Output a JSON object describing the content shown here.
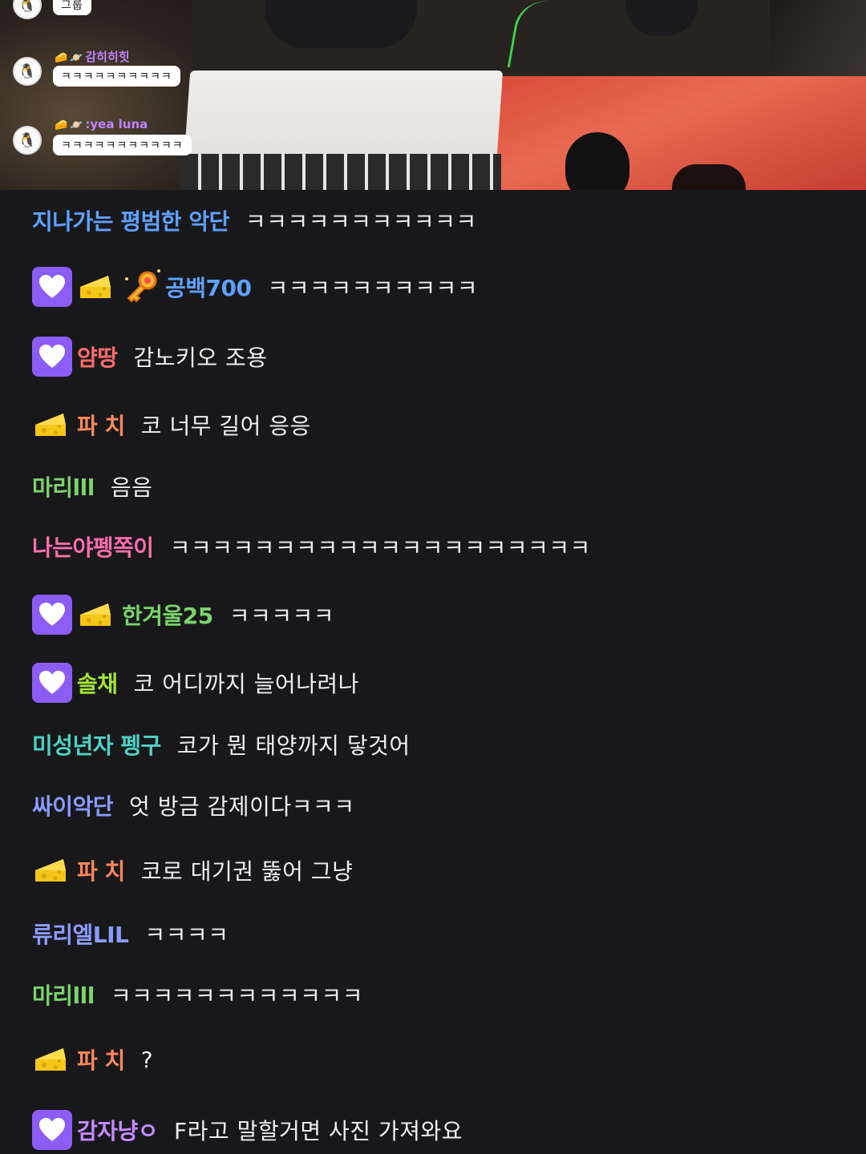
{
  "video_overlay": {
    "top_bubble": "그룹",
    "msg1": {
      "name": "감히히힛",
      "text": "ㅋㅋㅋㅋㅋㅋㅋㅋㅋㅋ"
    },
    "msg2": {
      "name": ":yea luna",
      "text": "ㅋㅋㅋㅋㅋㅋㅋㅋㅋㅋㅋ"
    }
  },
  "chat": {
    "messages": [
      {
        "user": "지나가는 평범한 악단",
        "color": "#5ea1ff",
        "badges": [],
        "text": "ㅋㅋㅋㅋㅋㅋㅋㅋㅋㅋㅋ"
      },
      {
        "user": "공백700",
        "color": "#5ea1ff",
        "badges": [
          "sub-heart-icon",
          "cheese-icon",
          "key-icon"
        ],
        "text": "ㅋㅋㅋㅋㅋㅋㅋㅋㅋㅋ"
      },
      {
        "user": "얌땅",
        "color": "#ff6b6b",
        "badges": [
          "sub-heart-icon"
        ],
        "text": "감노키오 조용"
      },
      {
        "user": "파 치",
        "color": "#ff8a5c",
        "badges": [
          "cheese-icon"
        ],
        "text": "코 너무 길어 응응"
      },
      {
        "user": "마리lll",
        "color": "#7bd36b",
        "badges": [],
        "text": "음음"
      },
      {
        "user": "나는야펭쪽이",
        "color": "#ff6fa8",
        "badges": [],
        "text": "ㅋㅋㅋㅋㅋㅋㅋㅋㅋㅋㅋㅋㅋㅋㅋㅋㅋㅋㅋㅋ"
      },
      {
        "user": "한겨울25",
        "color": "#7bd36b",
        "badges": [
          "sub-heart-icon",
          "cheese-icon"
        ],
        "text": "ㅋㅋㅋㅋㅋ"
      },
      {
        "user": "솔채",
        "color": "#a3e635",
        "badges": [
          "sub-heart-icon"
        ],
        "text": "코 어디까지 늘어나려나"
      },
      {
        "user": "미성년자 펭구",
        "color": "#4fd1c5",
        "badges": [],
        "text": "코가 뭔 태양까지 닿것어"
      },
      {
        "user": "싸이악단",
        "color": "#8b9cff",
        "badges": [],
        "text": "엇 방금 감제이다ㅋㅋㅋ"
      },
      {
        "user": "파 치",
        "color": "#ff8a5c",
        "badges": [
          "cheese-icon"
        ],
        "text": "코로 대기권 뚫어 그냥"
      },
      {
        "user": "류리엘LIL",
        "color": "#8b9cff",
        "badges": [],
        "text": "ㅋㅋㅋㅋ"
      },
      {
        "user": "마리lll",
        "color": "#7bd36b",
        "badges": [],
        "text": "ㅋㅋㅋㅋㅋㅋㅋㅋㅋㅋㅋㅋ"
      },
      {
        "user": "파 치",
        "color": "#ff8a5c",
        "badges": [
          "cheese-icon"
        ],
        "text": "?"
      },
      {
        "user": "감자냥ㅇ",
        "color": "#c48cff",
        "badges": [
          "sub-heart-icon"
        ],
        "text": "F라고 말할거면 사진 가져와요"
      }
    ]
  }
}
